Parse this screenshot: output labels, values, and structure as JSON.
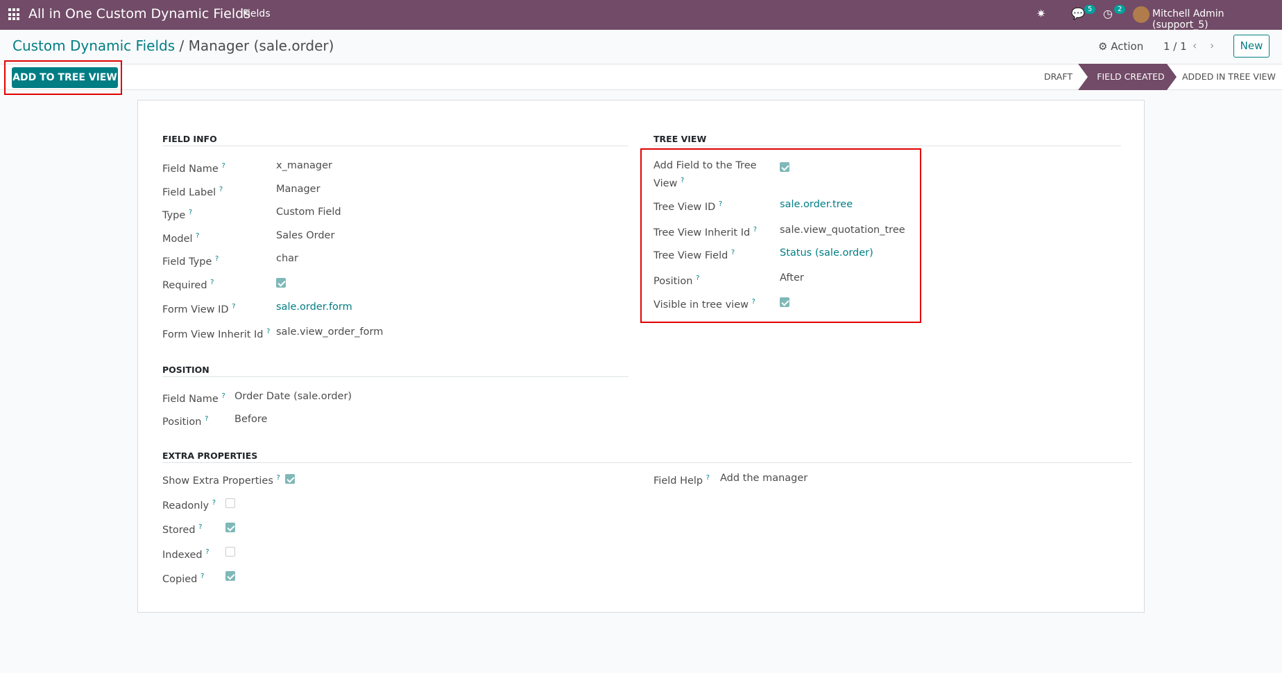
{
  "topbar": {
    "brand": "All in One Custom Dynamic Fields",
    "menu_fields": "Fields",
    "messages_count": "5",
    "activities_count": "2",
    "user": "Mitchell Admin (support_5)",
    "bug_icon": "bug-icon",
    "chat_icon": "chat-icon",
    "clock_icon": "clock-icon"
  },
  "header": {
    "breadcrumb_root": "Custom Dynamic Fields",
    "breadcrumb_sep": "/",
    "breadcrumb_current": "Manager (sale.order)",
    "action_label": "Action",
    "pager": "1 / 1",
    "new_label": "New"
  },
  "statusbar": {
    "add_button": "ADD TO TREE VIEW",
    "stages": [
      "DRAFT",
      "FIELD CREATED",
      "ADDED IN TREE VIEW"
    ],
    "active_stage": "FIELD CREATED"
  },
  "field_info": {
    "title": "FIELD INFO",
    "rows": [
      {
        "label": "Field Name",
        "value": "x_manager",
        "kind": "text"
      },
      {
        "label": "Field Label",
        "value": "Manager",
        "kind": "text"
      },
      {
        "label": "Type",
        "value": "Custom Field",
        "kind": "text"
      },
      {
        "label": "Model",
        "value": "Sales Order",
        "kind": "text"
      },
      {
        "label": "Field Type",
        "value": "char",
        "kind": "text"
      },
      {
        "label": "Required",
        "value": true,
        "kind": "checkbox"
      },
      {
        "label": "Form View ID",
        "value": "sale.order.form",
        "kind": "link"
      },
      {
        "label": "Form View Inherit Id",
        "value": "sale.view_order_form",
        "kind": "text"
      }
    ]
  },
  "tree_view": {
    "title": "TREE VIEW",
    "rows": [
      {
        "label": "Add Field to the Tree View",
        "value": true,
        "kind": "checkbox"
      },
      {
        "label": "Tree View ID",
        "value": "sale.order.tree",
        "kind": "link"
      },
      {
        "label": "Tree View Inherit Id",
        "value": "sale.view_quotation_tree",
        "kind": "text"
      },
      {
        "label": "Tree View Field",
        "value": "Status (sale.order)",
        "kind": "link"
      },
      {
        "label": "Position",
        "value": "After",
        "kind": "text"
      },
      {
        "label": "Visible in tree view",
        "value": true,
        "kind": "checkbox"
      }
    ]
  },
  "position": {
    "title": "POSITION",
    "rows": [
      {
        "label": "Field Name",
        "value": "Order Date (sale.order)"
      },
      {
        "label": "Position",
        "value": "Before"
      }
    ]
  },
  "extra": {
    "title": "EXTRA PROPERTIES",
    "rows": [
      {
        "label": "Show Extra Properties",
        "value": true
      },
      {
        "label": "Readonly",
        "value": false
      },
      {
        "label": "Stored",
        "value": true
      },
      {
        "label": "Indexed",
        "value": false
      },
      {
        "label": "Copied",
        "value": true
      }
    ],
    "help_label": "Field Help",
    "help_value": "Add the manager"
  },
  "colors": {
    "brand": "#714b67",
    "accent": "#017e84",
    "highlight": "#e10000"
  }
}
